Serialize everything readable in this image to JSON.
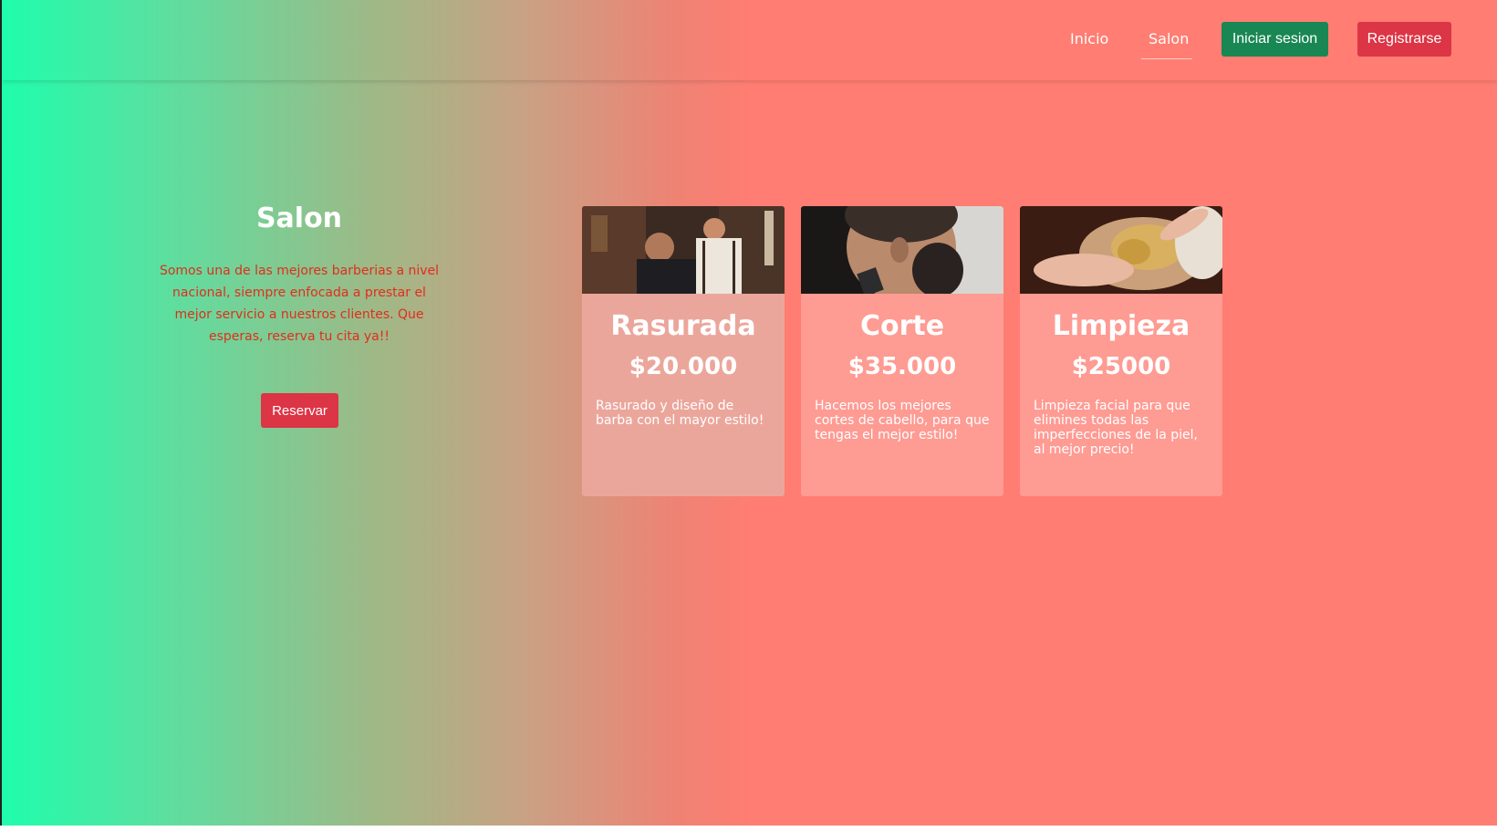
{
  "nav": {
    "links": [
      {
        "label": "Inicio"
      },
      {
        "label": "Salon"
      }
    ],
    "login_label": "Iniciar sesion",
    "register_label": "Registrarse"
  },
  "hero": {
    "title": "Salon",
    "text": "Somos una de las mejores barberias a nivel nacional, siempre enfocada a prestar el mejor servicio a nuestros clientes. Que esperas, reserva tu cita ya!!",
    "button_label": "Reservar"
  },
  "cards": [
    {
      "title": "Rasurada",
      "price": "$20.000",
      "description": "Rasurado y diseño de barba con el mayor estilo!",
      "image": "barber-shaving-photo"
    },
    {
      "title": "Corte",
      "price": "$35.000",
      "description": "Hacemos los mejores cortes de cabello, para que tengas el mejor estilo!",
      "image": "haircut-photo"
    },
    {
      "title": "Limpieza",
      "price": "$25000",
      "description": "Limpieza facial para que elimines todas las imperfecciones de la piel, al mejor precio!",
      "image": "facial-cleaning-photo"
    }
  ],
  "colors": {
    "gradient_start": "#1ffdac",
    "gradient_end": "#ff7d72",
    "login_button": "#198754",
    "register_button": "#dc3545",
    "hero_text": "#e02e1d"
  }
}
